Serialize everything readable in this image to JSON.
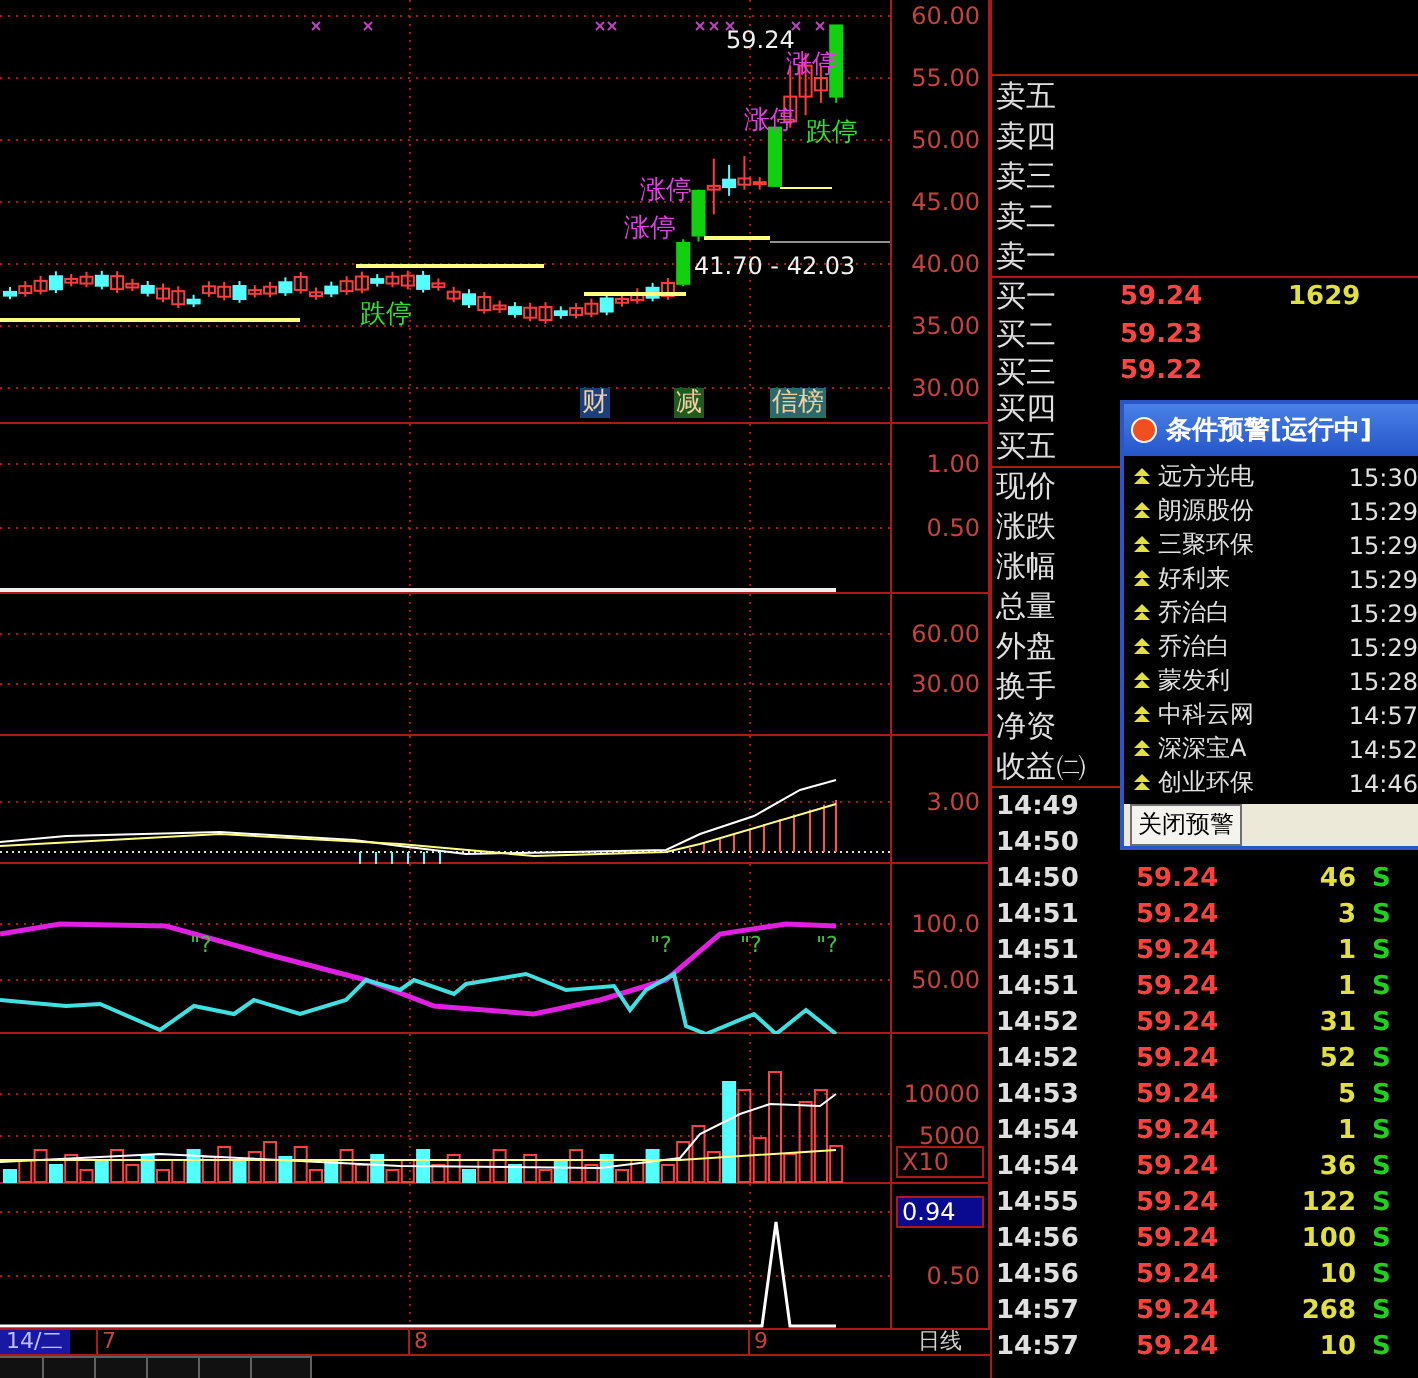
{
  "main_chart": {
    "ticks": [
      "60.00",
      "55.00",
      "50.00",
      "45.00",
      "40.00",
      "35.00",
      "30.00"
    ],
    "annotations": [
      {
        "kind": "price",
        "text": "59.24"
      },
      {
        "kind": "limit_up",
        "text": "涨停"
      },
      {
        "kind": "limit_up",
        "text": "涨停"
      },
      {
        "kind": "limit_down",
        "text": "跌停"
      },
      {
        "kind": "limit_up",
        "text": "涨停"
      },
      {
        "kind": "limit_up",
        "text": "涨停"
      },
      {
        "kind": "price",
        "text": "41.70 - 42.03"
      },
      {
        "kind": "limit_down",
        "text": "跌停"
      }
    ],
    "markers": [
      {
        "text": "财",
        "color": "#1a3f7a"
      },
      {
        "text": "减",
        "color": "#1f5a1f"
      },
      {
        "text": "信榜",
        "color": "#2a6a6a"
      }
    ]
  },
  "indicator_1": {
    "ticks": [
      "1.00",
      "0.50"
    ]
  },
  "indicator_2": {
    "ticks": [
      "60.00",
      "30.00"
    ]
  },
  "indicator_3": {
    "ticks": [
      "3.00"
    ]
  },
  "indicator_4": {
    "ticks": [
      "100.0",
      "50.00"
    ],
    "signals": [
      "\"?",
      "\"?",
      "\"?",
      "\"?"
    ]
  },
  "volume": {
    "ticks": [
      "10000",
      "5000"
    ],
    "scale": "X10"
  },
  "indicator_5": {
    "current": "0.94",
    "ticks": [
      "0.50"
    ]
  },
  "date_axis": {
    "range": "14/二",
    "dates": [
      "7",
      "8",
      "9"
    ],
    "period": "日线"
  },
  "order_book": {
    "sell": [
      {
        "label": "卖五"
      },
      {
        "label": "卖四"
      },
      {
        "label": "卖三"
      },
      {
        "label": "卖二"
      },
      {
        "label": "卖一"
      }
    ],
    "buy": [
      {
        "label": "买一",
        "price": "59.24",
        "volume": "1629"
      },
      {
        "label": "买二",
        "price": "59.23"
      },
      {
        "label": "买三",
        "price": "59.22"
      },
      {
        "label": "买四"
      },
      {
        "label": "买五"
      }
    ]
  },
  "quote_labels": [
    "现价",
    "涨跌",
    "涨幅",
    "总量",
    "外盘",
    "换手",
    "净资",
    "收益㈡"
  ],
  "trades": [
    {
      "time": "14:49"
    },
    {
      "time": "14:50"
    },
    {
      "time": "14:50",
      "price": "59.24",
      "volume": "46",
      "side": "S"
    },
    {
      "time": "14:51",
      "price": "59.24",
      "volume": "3",
      "side": "S"
    },
    {
      "time": "14:51",
      "price": "59.24",
      "volume": "1",
      "side": "S"
    },
    {
      "time": "14:51",
      "price": "59.24",
      "volume": "1",
      "side": "S"
    },
    {
      "time": "14:52",
      "price": "59.24",
      "volume": "31",
      "side": "S"
    },
    {
      "time": "14:52",
      "price": "59.24",
      "volume": "52",
      "side": "S"
    },
    {
      "time": "14:53",
      "price": "59.24",
      "volume": "5",
      "side": "S"
    },
    {
      "time": "14:54",
      "price": "59.24",
      "volume": "1",
      "side": "S"
    },
    {
      "time": "14:54",
      "price": "59.24",
      "volume": "36",
      "side": "S"
    },
    {
      "time": "14:55",
      "price": "59.24",
      "volume": "122",
      "side": "S"
    },
    {
      "time": "14:56",
      "price": "59.24",
      "volume": "100",
      "side": "S"
    },
    {
      "time": "14:56",
      "price": "59.24",
      "volume": "10",
      "side": "S"
    },
    {
      "time": "14:57",
      "price": "59.24",
      "volume": "268",
      "side": "S"
    },
    {
      "time": "14:57",
      "price": "59.24",
      "volume": "10",
      "side": "S"
    }
  ],
  "alert_popup": {
    "title": "条件预警[运行中]",
    "items": [
      {
        "name": "远方光电",
        "time": "15:30"
      },
      {
        "name": "朗源股份",
        "time": "15:29"
      },
      {
        "name": "三聚环保",
        "time": "15:29"
      },
      {
        "name": "好利来",
        "time": "15:29"
      },
      {
        "name": "乔治白",
        "time": "15:29"
      },
      {
        "name": "乔治白",
        "time": "15:29"
      },
      {
        "name": "蒙发利",
        "time": "15:28"
      },
      {
        "name": "中科云网",
        "time": "14:57"
      },
      {
        "name": "深深宝A",
        "time": "14:52"
      },
      {
        "name": "创业环保",
        "time": "14:46"
      }
    ],
    "close_button": "关闭预警"
  }
}
